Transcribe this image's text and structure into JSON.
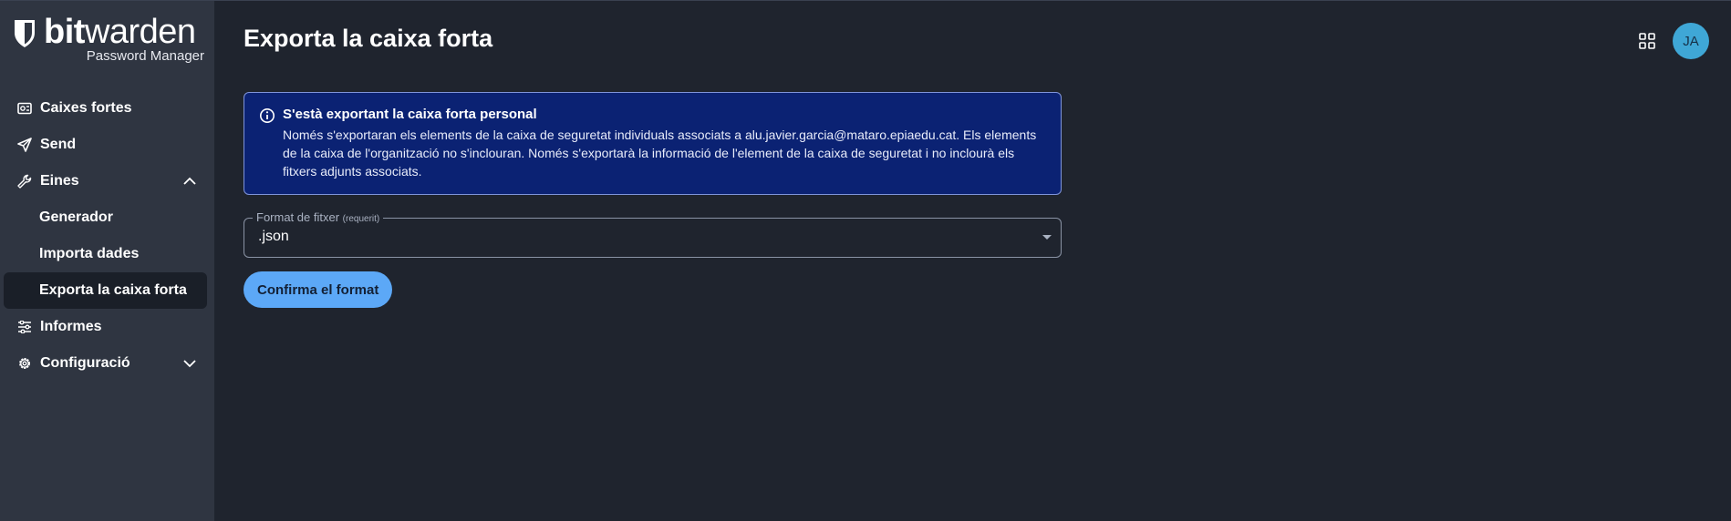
{
  "brand": {
    "name_bold": "bit",
    "name_light": "warden",
    "subtitle": "Password Manager"
  },
  "sidebar": {
    "items": [
      {
        "label": "Caixes fortes",
        "icon": "vault-icon"
      },
      {
        "label": "Send",
        "icon": "send-icon"
      },
      {
        "label": "Eines",
        "icon": "wrench-icon",
        "expanded": true
      },
      {
        "label": "Generador"
      },
      {
        "label": "Importa dades"
      },
      {
        "label": "Exporta la caixa forta",
        "active": true
      },
      {
        "label": "Informes",
        "icon": "sliders-icon"
      },
      {
        "label": "Configuració",
        "icon": "gear-icon",
        "expanded": false
      }
    ]
  },
  "header": {
    "title": "Exporta la caixa forta",
    "avatar_initials": "JA"
  },
  "callout": {
    "title": "S'està exportant la caixa forta personal",
    "body": "Només s'exportaran els elements de la caixa de seguretat individuals associats a alu.javier.garcia@mataro.epiaedu.cat. Els elements de la caixa de l'organització no s'inclouran. Només s'exportarà la informació de l'element de la caixa de seguretat i no inclourà els fitxers adjunts associats."
  },
  "format_field": {
    "label": "Format de fitxer",
    "required": "(requerit)",
    "value": ".json"
  },
  "confirm_button": "Confirma el format",
  "colors": {
    "sidebar_bg": "#2f3541",
    "main_bg": "#1f242e",
    "callout_bg": "#0b2273",
    "button_bg": "#5ca8f7",
    "avatar_bg": "#3fa7d6"
  }
}
